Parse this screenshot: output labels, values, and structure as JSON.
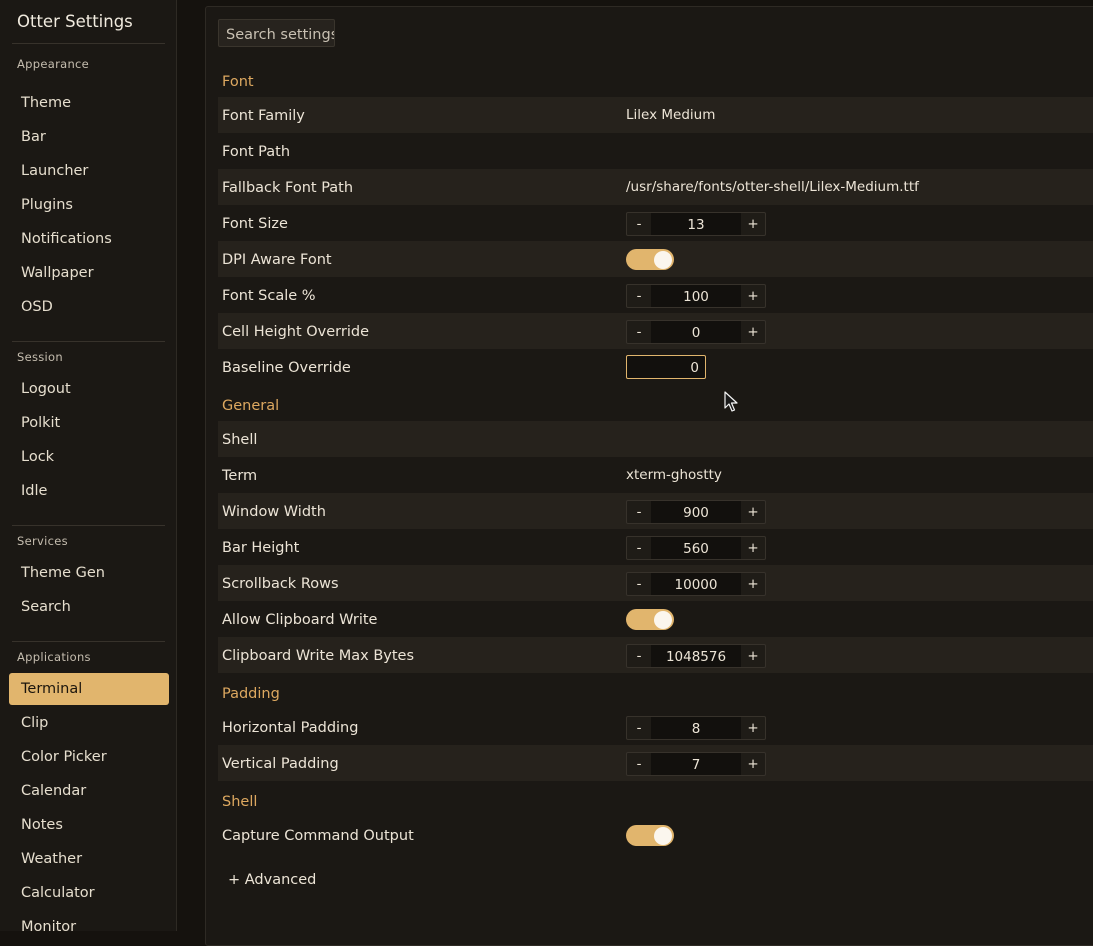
{
  "app": {
    "title": "Otter Settings"
  },
  "sidebar": {
    "sections": [
      {
        "label": "Appearance",
        "items": [
          "Theme",
          "Bar",
          "Launcher",
          "Plugins",
          "Notifications",
          "Wallpaper",
          "OSD"
        ]
      },
      {
        "label": "Session",
        "items": [
          "Logout",
          "Polkit",
          "Lock",
          "Idle"
        ]
      },
      {
        "label": "Services",
        "items": [
          "Theme Gen",
          "Search"
        ]
      },
      {
        "label": "Applications",
        "items": [
          "Terminal",
          "Clip",
          "Color Picker",
          "Calendar",
          "Notes",
          "Weather",
          "Calculator",
          "Monitor"
        ]
      }
    ],
    "active_item": "Terminal"
  },
  "search": {
    "placeholder": "Search settings"
  },
  "groups": {
    "font": {
      "title": "Font",
      "font_family": {
        "label": "Font Family",
        "value": "Lilex Medium"
      },
      "font_path": {
        "label": "Font Path",
        "value": ""
      },
      "fallback_font_path": {
        "label": "Fallback Font Path",
        "value": "/usr/share/fonts/otter-shell/Lilex-Medium.ttf"
      },
      "font_size": {
        "label": "Font Size",
        "value": "13"
      },
      "dpi_aware_font": {
        "label": "DPI Aware Font",
        "enabled": true
      },
      "font_scale": {
        "label": "Font Scale %",
        "value": "100"
      },
      "cell_height_override": {
        "label": "Cell Height Override",
        "value": "0"
      },
      "baseline_override": {
        "label": "Baseline Override",
        "value": "0"
      }
    },
    "general": {
      "title": "General",
      "shell": {
        "label": "Shell",
        "value": ""
      },
      "term": {
        "label": "Term",
        "value": "xterm-ghostty"
      },
      "window_width": {
        "label": "Window Width",
        "value": "900"
      },
      "bar_height": {
        "label": "Bar Height",
        "value": "560"
      },
      "scrollback_rows": {
        "label": "Scrollback Rows",
        "value": "10000"
      },
      "allow_clipboard_write": {
        "label": "Allow Clipboard Write",
        "enabled": true
      },
      "clipboard_write_max_bytes": {
        "label": "Clipboard Write Max Bytes",
        "value": "1048576"
      }
    },
    "padding": {
      "title": "Padding",
      "horizontal_padding": {
        "label": "Horizontal Padding",
        "value": "8"
      },
      "vertical_padding": {
        "label": "Vertical Padding",
        "value": "7"
      }
    },
    "shell": {
      "title": "Shell",
      "capture_command_output": {
        "label": "Capture Command Output",
        "enabled": true
      }
    }
  },
  "stepper": {
    "minus": "-",
    "plus": "+"
  },
  "advanced": {
    "label": "+ Advanced"
  },
  "colors": {
    "accent": "#e1b56d",
    "group_title": "#dda860",
    "background": "#15120e",
    "panel": "#1b1814",
    "row_shade": "#26221c"
  }
}
